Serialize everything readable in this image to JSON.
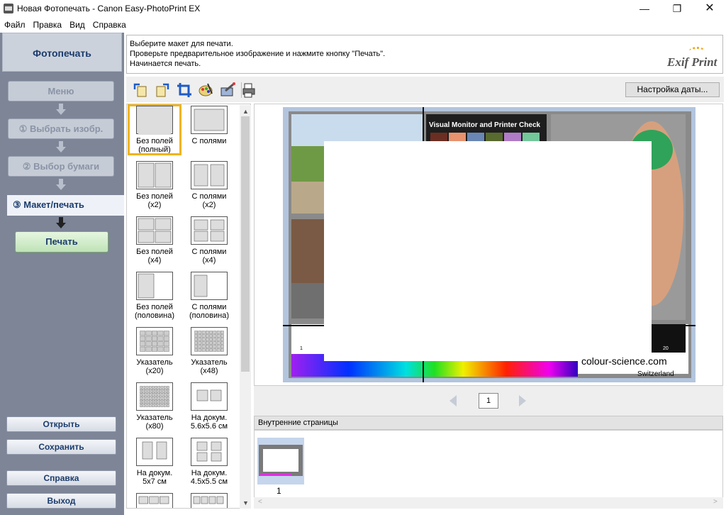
{
  "window": {
    "title": "Новая Фотопечать - Canon Easy-PhotoPrint EX"
  },
  "menu": [
    "Файл",
    "Правка",
    "Вид",
    "Справка"
  ],
  "sidebar": {
    "title": "Фотопечать",
    "steps": [
      {
        "label": "Меню"
      },
      {
        "label": "① Выбрать изобр."
      },
      {
        "label": "② Выбор бумаги"
      },
      {
        "label": "③  Макет/печать"
      }
    ],
    "print_label": "Печать",
    "open_label": "Открыть",
    "save_label": "Сохранить",
    "help_label": "Справка",
    "exit_label": "Выход"
  },
  "instructions": {
    "line1": "Выберите макет для печати.",
    "line2": "Проверьте предварительное изображение и нажмите кнопку \"Печать\".",
    "line3": "Начинается печать.",
    "logo": "Exif Print"
  },
  "toolbar": {
    "date_settings": "Настройка даты..."
  },
  "layouts": [
    {
      "line1": "Без полей",
      "line2": "(полный)"
    },
    {
      "line1": "С полями",
      "line2": ""
    },
    {
      "line1": "Без полей",
      "line2": "(x2)"
    },
    {
      "line1": "С полями",
      "line2": "(x2)"
    },
    {
      "line1": "Без полей",
      "line2": "(x4)"
    },
    {
      "line1": "С полями",
      "line2": "(x4)"
    },
    {
      "line1": "Без полей",
      "line2": "(половина)"
    },
    {
      "line1": "С полями",
      "line2": "(половина)"
    },
    {
      "line1": "Указатель",
      "line2": "(x20)"
    },
    {
      "line1": "Указатель",
      "line2": "(x48)"
    },
    {
      "line1": "Указатель",
      "line2": "(x80)"
    },
    {
      "line1": "На докум.",
      "line2": "5.6x5.6 см"
    },
    {
      "line1": "На докум.",
      "line2": "5x7 см"
    },
    {
      "line1": "На докум.",
      "line2": "4.5x5.5 см"
    },
    {
      "line1": "",
      "line2": ""
    },
    {
      "line1": "",
      "line2": ""
    }
  ],
  "preview": {
    "chart_title": "Visual Monitor and Printer Check",
    "site": "colour-science.com",
    "country": "Switzerland",
    "gray_labels": [
      "1",
      "20"
    ]
  },
  "pager": {
    "page": "1"
  },
  "inner_pages": {
    "header": "Внутренние страницы",
    "thumb_label": "1"
  }
}
